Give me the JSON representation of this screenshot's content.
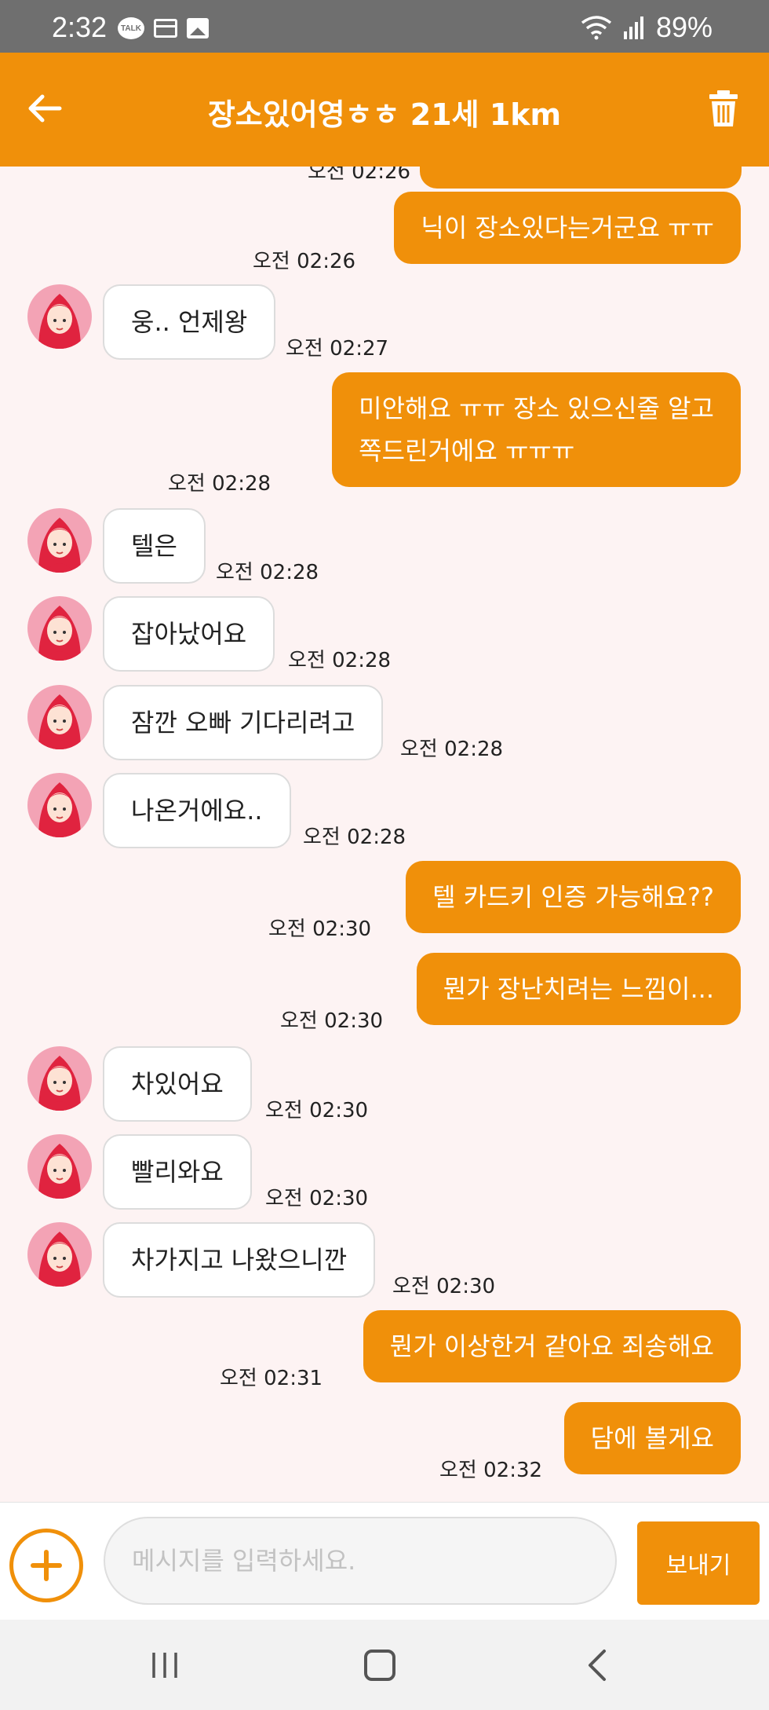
{
  "status_bar": {
    "time": "2:32",
    "talk_icon_text": "TALK",
    "battery": "89%"
  },
  "header": {
    "title": "장소있어영ㅎㅎ 21세 1km"
  },
  "chat": {
    "partial_time": "오전 02:26",
    "messages": [
      {
        "side": "out",
        "text": "닉이 장소있다는거군요 ㅠㅠ",
        "time": "오전 02:26"
      },
      {
        "side": "in",
        "text": "웅.. 언제왕",
        "time": "오전 02:27"
      },
      {
        "side": "out",
        "text": "미안해요 ㅠㅠ 장소 있으신줄 알고\n쪽드린거에요 ㅠㅠㅠ",
        "time": "오전 02:28"
      },
      {
        "side": "in",
        "text": "텔은",
        "time": "오전 02:28"
      },
      {
        "side": "in",
        "text": "잡아났어요",
        "time": "오전 02:28"
      },
      {
        "side": "in",
        "text": "잠깐 오빠 기다리려고",
        "time": "오전 02:28"
      },
      {
        "side": "in",
        "text": "나온거에요..",
        "time": "오전 02:28"
      },
      {
        "side": "out",
        "text": "텔 카드키 인증 가능해요??",
        "time": "오전 02:30"
      },
      {
        "side": "out",
        "text": "뭔가 장난치려는 느낌이...",
        "time": "오전 02:30"
      },
      {
        "side": "in",
        "text": "차있어요",
        "time": "오전 02:30"
      },
      {
        "side": "in",
        "text": "빨리와요",
        "time": "오전 02:30"
      },
      {
        "side": "in",
        "text": "차가지고 나왔으니깐",
        "time": "오전 02:30"
      },
      {
        "side": "out",
        "text": "뭔가 이상한거 같아요 죄송해요",
        "time": "오전 02:31"
      },
      {
        "side": "out",
        "text": "담에 볼게요",
        "time": "오전 02:32"
      }
    ]
  },
  "input_bar": {
    "placeholder": "메시지를 입력하세요.",
    "send_label": "보내기"
  },
  "colors": {
    "accent": "#f0900a",
    "chat_background": "#fdf3f3",
    "status_bar": "#6f6f6f"
  },
  "icons": [
    "back-arrow-icon",
    "trash-icon",
    "plus-icon",
    "avatar-icon",
    "wifi-icon",
    "signal-icon"
  ]
}
